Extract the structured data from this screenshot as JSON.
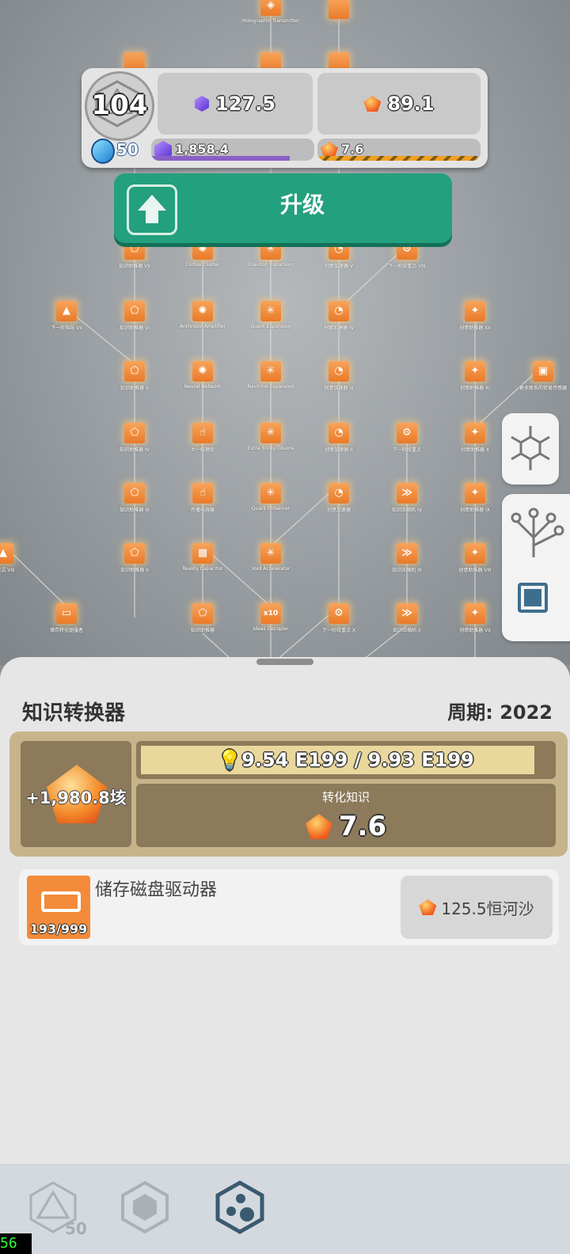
{
  "tree": {
    "nodes": [
      {
        "label": "Holographic Transmitter",
        "icon": "hologram-icon",
        "glyph": "◈"
      },
      {
        "label": "知识助推器 VII",
        "icon": "pentagon-icon",
        "glyph": "⬠"
      },
      {
        "label": "Cortex Cluster",
        "icon": "brain-icon",
        "glyph": "✺"
      },
      {
        "label": "Graviton Expansion",
        "icon": "atom-icon",
        "glyph": "✳"
      },
      {
        "label": "创意加速器 V",
        "icon": "gauge-icon",
        "glyph": "◔"
      },
      {
        "label": "下一阶段重点 VIII",
        "icon": "gear-icon",
        "glyph": "⚙"
      },
      {
        "label": "下一阶指导 VII",
        "icon": "warning-icon",
        "glyph": "▲"
      },
      {
        "label": "知识助推器 VI",
        "icon": "pentagon-icon",
        "glyph": "⬠"
      },
      {
        "label": "Anthropic Amplifier",
        "icon": "brain-icon",
        "glyph": "✺"
      },
      {
        "label": "Quark Expansion",
        "icon": "atom-icon",
        "glyph": "✳"
      },
      {
        "label": "创意加速器 IV",
        "icon": "gauge-icon",
        "glyph": "◔"
      },
      {
        "label": "创意助推器 XII",
        "icon": "bulb-icon",
        "glyph": "✦"
      },
      {
        "label": "知识助推器 V",
        "icon": "pentagon-icon",
        "glyph": "⬠"
      },
      {
        "label": "Neural Network",
        "icon": "brain-icon",
        "glyph": "✺"
      },
      {
        "label": "Neutrino Expansion",
        "icon": "atom-icon",
        "glyph": "✳"
      },
      {
        "label": "创意加速器 III",
        "icon": "gauge-icon",
        "glyph": "◔"
      },
      {
        "label": "创意助推器 XI",
        "icon": "bulb-icon",
        "glyph": "✦"
      },
      {
        "label": "更多联系的贸易传感器",
        "icon": "cube-icon",
        "glyph": "▣"
      },
      {
        "label": "知识助推器 IV",
        "icon": "pentagon-icon",
        "glyph": "⬠"
      },
      {
        "label": "大一统理论",
        "icon": "hand-icon",
        "glyph": "☝"
      },
      {
        "label": "Extra Sticky Gluons",
        "icon": "atom-icon",
        "glyph": "✳"
      },
      {
        "label": "创意加速器 II",
        "icon": "gauge-icon",
        "glyph": "◔"
      },
      {
        "label": "下一阶段重点",
        "icon": "gear-icon",
        "glyph": "⚙"
      },
      {
        "label": "创意助推器 X",
        "icon": "bulb-icon",
        "glyph": "✦"
      },
      {
        "label": "知识助推器 III",
        "icon": "pentagon-icon",
        "glyph": "⬠"
      },
      {
        "label": "传播电容器",
        "icon": "hand-icon",
        "glyph": "☝"
      },
      {
        "label": "Quark Enhancer",
        "icon": "atom-icon",
        "glyph": "✳"
      },
      {
        "label": "创意加速器",
        "icon": "gauge-icon",
        "glyph": "◔"
      },
      {
        "label": "知识压缩机 IV",
        "icon": "chevron-icon",
        "glyph": "≫"
      },
      {
        "label": "创意助推器 IX",
        "icon": "bulb-icon",
        "glyph": "✦"
      },
      {
        "label": "组成式 VIII",
        "icon": "warning-icon",
        "glyph": "▲"
      },
      {
        "label": "知识助推器 II",
        "icon": "pentagon-icon",
        "glyph": "⬠"
      },
      {
        "label": "Reality Capacitor",
        "icon": "chip-icon",
        "glyph": "▦"
      },
      {
        "label": "Void Accelerator",
        "icon": "atom-icon",
        "glyph": "✳"
      },
      {
        "label": "知识压缩机 III",
        "icon": "chevron-icon",
        "glyph": "≫"
      },
      {
        "label": "创意助推器 VIII",
        "icon": "bulb-icon",
        "glyph": "✦"
      },
      {
        "label": "储存转化驱服者",
        "icon": "drive-icon",
        "glyph": "▭"
      },
      {
        "label": "知识助推器",
        "icon": "pentagon-icon",
        "glyph": "⬠"
      },
      {
        "label": "Ideas Decupler",
        "icon": "x10-icon",
        "glyph": "x10"
      },
      {
        "label": "下一阶段重点 X",
        "icon": "gear-icon",
        "glyph": "⚙"
      },
      {
        "label": "知识压缩机 II",
        "icon": "chevron-icon",
        "glyph": "≫"
      },
      {
        "label": "创意助推器 VII",
        "icon": "bulb-icon",
        "glyph": "✦"
      }
    ]
  },
  "stats": {
    "level": "104",
    "purple_value": "127.5",
    "orange_value": "89.1",
    "blue_coin_count": "50",
    "purple_bar_value": "1,858.4",
    "purple_bar_progress": 0.85,
    "orange_bar_value": "7.6",
    "orange_bar_progress": 0.98
  },
  "upgrade": {
    "label": "升级"
  },
  "panel": {
    "title": "知识转换器",
    "cycle": "周期: 2022",
    "gain": "+1,980.8垓",
    "progress_text": "9.54 E199 / 9.93 E199",
    "progress": 0.96,
    "convert_label": "转化知识",
    "convert_value": "7.6"
  },
  "disk": {
    "name": "储存磁盘驱动器",
    "count": "193/999",
    "cost": "125.5恒河沙"
  },
  "nav": {
    "count": "50"
  },
  "fps": "56",
  "colors": {
    "accent_green": "#23a07d",
    "purple_bar": "#8a5fc8",
    "orange_bar": "#f0a020",
    "node_orange": "#ef8a3a"
  }
}
